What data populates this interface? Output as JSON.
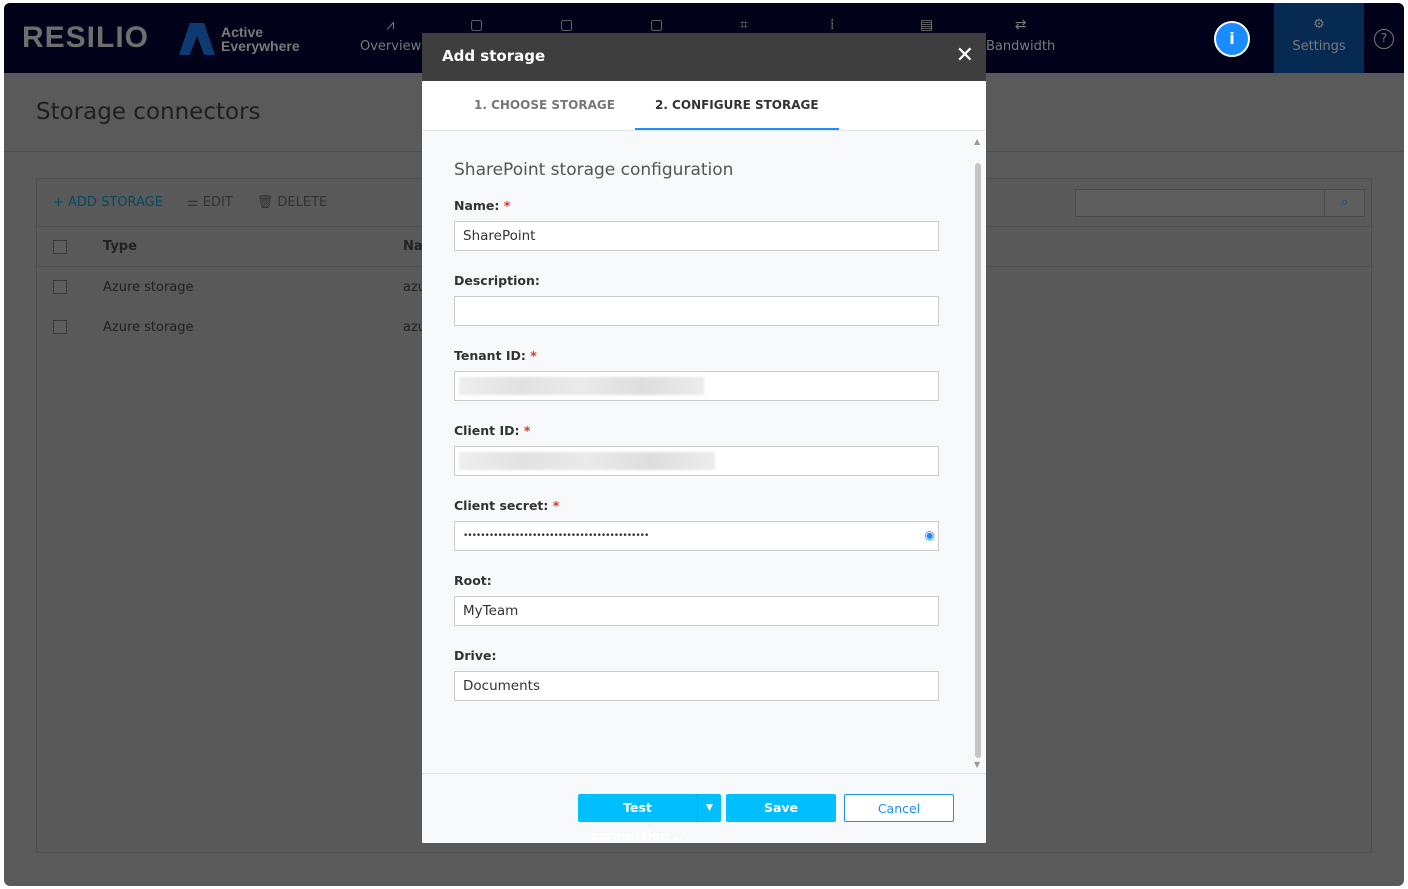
{
  "header": {
    "logo": "RESILIO",
    "product_line1": "Active",
    "product_line2": "Everywhere",
    "nav": [
      {
        "label": "Overview"
      },
      {
        "label": ""
      },
      {
        "label": ""
      },
      {
        "label": ""
      },
      {
        "label": ""
      },
      {
        "label": ""
      },
      {
        "label": ""
      },
      {
        "label": "Bandwidth"
      }
    ],
    "settings": "Settings",
    "info": "i",
    "help": "?"
  },
  "page": {
    "title": "Storage connectors"
  },
  "toolbar": {
    "add": "ADD STORAGE",
    "edit": "EDIT",
    "delete": "DELETE"
  },
  "table": {
    "columns": [
      "Type",
      "Na"
    ],
    "rows": [
      [
        "Azure storage",
        "azu"
      ],
      [
        "Azure storage",
        "azu"
      ]
    ]
  },
  "modal": {
    "title": "Add storage",
    "tabs": [
      "1. CHOOSE STORAGE",
      "2. CONFIGURE STORAGE"
    ],
    "section": "SharePoint storage configuration",
    "fields": [
      {
        "label": "Name:",
        "required": true,
        "value": "SharePoint"
      },
      {
        "label": "Description:",
        "required": false,
        "value": ""
      },
      {
        "label": "Tenant ID:",
        "required": true,
        "value": ""
      },
      {
        "label": "Client ID:",
        "required": true,
        "value": ""
      },
      {
        "label": "Client secret:",
        "required": true,
        "value": "•••••••••••••••••••••••••••••••••••••••••••"
      },
      {
        "label": "Root:",
        "required": false,
        "value": "MyTeam"
      },
      {
        "label": "Drive:",
        "required": false,
        "value": "Documents"
      }
    ],
    "required_mark": "*",
    "test": "Test connection...",
    "save": "Save",
    "cancel": "Cancel"
  }
}
